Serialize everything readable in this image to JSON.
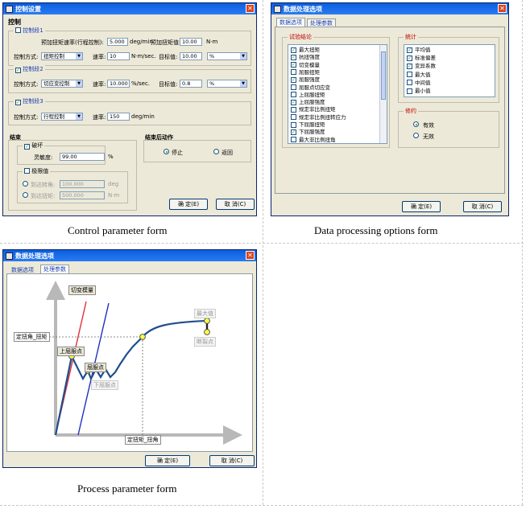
{
  "captions": {
    "control": "Control parameter form",
    "data_processing": "Data processing options form",
    "process": "Process parameter form"
  },
  "control_form": {
    "title": "控制设置",
    "heading": "控制",
    "seg1": {
      "label": "控制段1",
      "checked": false,
      "preload_rate_label": "预加扭矩速率(行程控制):",
      "preload_rate_value": "5.000",
      "preload_rate_unit": "deg/min",
      "preload_value_label": "预加扭矩值:",
      "preload_value": "10.00",
      "preload_value_unit": "N·m",
      "mode_label": "控制方式:",
      "mode_value": "扭矩控制",
      "rate_label": "速率:",
      "rate_value": "10",
      "rate_unit": "N·m/sec.",
      "target_label": "目标值:",
      "target_value": "10.00",
      "target_unit": "%"
    },
    "seg2": {
      "label": "控制段2",
      "checked": true,
      "mode_label": "控制方式:",
      "mode_value": "切应变控制",
      "rate_label": "速率:",
      "rate_value": "10.000",
      "rate_unit": "%/sec.",
      "target_label": "目标值:",
      "target_value": "0.8",
      "target_unit": "%"
    },
    "seg3": {
      "label": "控制段3",
      "checked": true,
      "mode_label": "控制方式:",
      "mode_value": "行程控制",
      "rate_label": "速率:",
      "rate_value": "150",
      "rate_unit": "deg/min"
    },
    "end_group": {
      "label": "结束",
      "break_label": "破坏",
      "break_checked": true,
      "sensitivity_label": "灵敏度:",
      "sensitivity_value": "99.00",
      "sensitivity_unit": "%",
      "limit_label": "极限值",
      "limit_checked": false,
      "angle_label": "到达转角:",
      "angle_value": "100.000",
      "angle_unit": "deg",
      "torque_label": "到达扭矩:",
      "torque_value": "500.000",
      "torque_unit": "N·m"
    },
    "after_end": {
      "label": "结束后动作",
      "stop_label": "停止",
      "return_label": "返回"
    },
    "ok_label": "确 定(E)",
    "cancel_label": "取 消(C)"
  },
  "data_form": {
    "title": "数据处理选项",
    "tabs": [
      "数据选项",
      "处理参数"
    ],
    "results_label": "试验结论",
    "results": [
      {
        "text": "最大扭矩",
        "checked": true
      },
      {
        "text": "抗扭强度",
        "checked": true
      },
      {
        "text": "切变模量",
        "checked": true
      },
      {
        "text": "屈服扭矩",
        "checked": false
      },
      {
        "text": "屈服强度",
        "checked": true
      },
      {
        "text": "屈服点切应变",
        "checked": false
      },
      {
        "text": "上屈服扭矩",
        "checked": false
      },
      {
        "text": "上屈服强度",
        "checked": true
      },
      {
        "text": "规定非比例扭矩",
        "checked": false
      },
      {
        "text": "规定非比例扭转应力",
        "checked": false
      },
      {
        "text": "下屈服扭矩",
        "checked": false
      },
      {
        "text": "下屈服强度",
        "checked": true
      },
      {
        "text": "最大非比例扭角",
        "checked": false
      }
    ],
    "stats_label": "统计",
    "stats": [
      {
        "text": "平均值",
        "checked": true
      },
      {
        "text": "标准偏差",
        "checked": true
      },
      {
        "text": "变异系数",
        "checked": true
      },
      {
        "text": "最大值",
        "checked": false
      },
      {
        "text": "中间值",
        "checked": false
      },
      {
        "text": "最小值",
        "checked": false
      }
    ],
    "round_label": "修约",
    "round_options": [
      {
        "text": "有效",
        "selected": true
      },
      {
        "text": "无效",
        "selected": false
      }
    ],
    "ok_label": "确 定(E)",
    "cancel_label": "取 消(C)"
  },
  "process_form": {
    "title": "数据处理选项",
    "tabs": [
      "数据选项",
      "处理参数"
    ],
    "labels": {
      "shear_modulus": "切变模量",
      "max_value": "最大值",
      "break_point": "断裂点",
      "fixed_angle_torque": "定扭角_扭矩",
      "upper_yield": "上屈服点",
      "yield_point": "屈服点",
      "lower_yield": "下屈服点",
      "fixed_torque_angle": "定扭矩_扭角"
    },
    "ok_label": "确 定(E)",
    "cancel_label": "取 消(C)"
  }
}
